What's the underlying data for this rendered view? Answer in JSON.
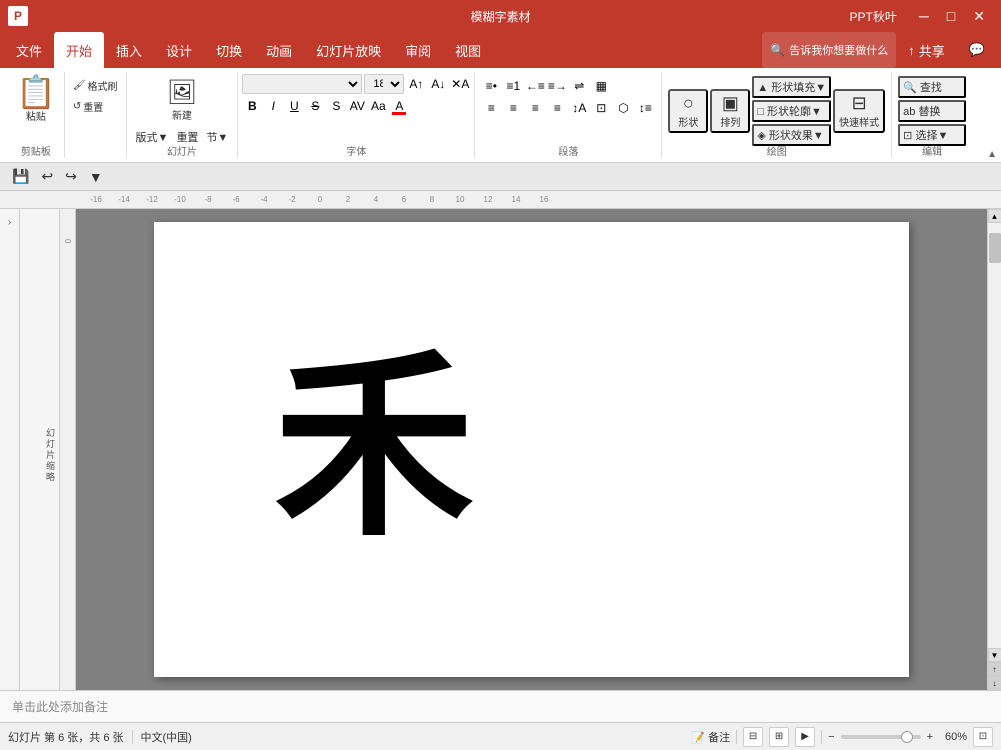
{
  "titleBar": {
    "appName": "模糊字素材",
    "rightTitle": "PPT秋叶",
    "winButtons": [
      "─",
      "□",
      "✕"
    ]
  },
  "menuBar": {
    "items": [
      "文件",
      "开始",
      "插入",
      "设计",
      "切换",
      "动画",
      "幻灯片放映",
      "审阅",
      "视图"
    ],
    "activeItem": "开始",
    "shareLabel": "共享",
    "searchPlaceholder": "告诉我你想要做什么"
  },
  "ribbon": {
    "groups": [
      {
        "name": "剪贴板",
        "buttons": [
          {
            "label": "粘贴",
            "icon": "📋"
          },
          {
            "label": "格式刷",
            "icon": "🖌"
          },
          {
            "sublabel": "重置"
          }
        ]
      },
      {
        "name": "幻灯片",
        "buttons": [
          {
            "label": "新建幻灯片",
            "icon": "＋"
          },
          {
            "label": "版式",
            "icon": "▦"
          },
          {
            "label": "重置"
          },
          {
            "label": "节"
          }
        ]
      },
      {
        "name": "字体",
        "fontName": "",
        "fontSize": "18",
        "formatButtons": [
          "B",
          "I",
          "U",
          "S",
          "A",
          "Aa",
          "A"
        ]
      },
      {
        "name": "段落",
        "buttons": [
          "≡",
          "≡",
          "≡"
        ]
      },
      {
        "name": "绘图",
        "buttons": [
          {
            "label": "形状",
            "icon": "○"
          },
          {
            "label": "排列",
            "icon": "▣"
          },
          {
            "label": "快速样式"
          }
        ]
      },
      {
        "name": "编辑",
        "buttons": [
          {
            "label": "查找"
          },
          {
            "label": "替换"
          },
          {
            "label": "选择"
          }
        ]
      }
    ]
  },
  "quickAccess": {
    "buttons": [
      "💾",
      "↩",
      "↪",
      "🔧",
      "🔲",
      "↗",
      "▼"
    ]
  },
  "ruler": {
    "marks": [
      "-16",
      "-14",
      "-12",
      "-10",
      "-8",
      "-6",
      "-4",
      "-2",
      "0",
      "2",
      "4",
      "6",
      "8",
      "10",
      "12",
      "14",
      "16"
    ]
  },
  "slideContent": {
    "char": "禾",
    "slideNote": "单击此处添加备注"
  },
  "statusBar": {
    "slideInfo": "幻灯片 第 6 张，共 6 张",
    "language": "中文(中国)",
    "notesLabel": "备注",
    "viewButtons": [
      "normal",
      "outline",
      "slideshow"
    ],
    "zoomLevel": "60%",
    "fitLabel": "适应窗口"
  }
}
